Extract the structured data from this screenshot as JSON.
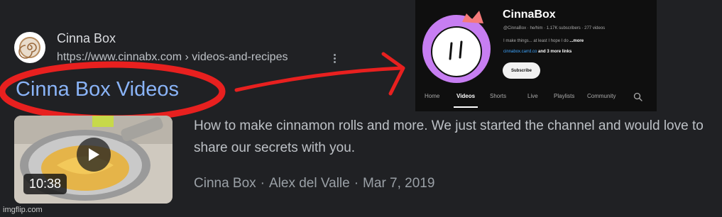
{
  "result": {
    "site_name": "Cinna Box",
    "site_url": "https://www.cinnabx.com › videos-and-recipes",
    "title": "Cinna Box Videos",
    "duration": "10:38",
    "description": "How to make cinnamon rolls and more. We just started the channel and would love to share our secrets with you.",
    "meta": {
      "source": "Cinna Box",
      "author": "Alex del Valle",
      "date": "Mar 7, 2019",
      "separator": "·"
    }
  },
  "youtube_channel": {
    "name": "CinnaBox",
    "stats": "@CinnaBox · he/him · 1.17K subscribers · 277 videos",
    "about_text": "I make things... at least I hope I do",
    "about_more": "...more",
    "link_text": "cinnabox.carrd.co",
    "more_links": "and 3 more links",
    "subscribe_label": "Subscribe",
    "tabs": [
      {
        "label": "Home"
      },
      {
        "label": "Videos"
      },
      {
        "label": "Shorts"
      },
      {
        "label": "Live"
      },
      {
        "label": "Playlists"
      },
      {
        "label": "Community"
      }
    ],
    "active_tab": "Videos"
  },
  "watermark": "imgflip.com",
  "colors": {
    "background": "#202124",
    "link_blue": "#8ab4f8",
    "annotation_red": "#e8201f",
    "youtube_bg": "#0f0f0f",
    "avatar_purple": "#c77ef2",
    "crown_pink": "#f47a7a"
  },
  "icons": [
    "cinnamon-roll-icon",
    "kebab-menu-icon",
    "play-icon",
    "search-icon",
    "crown-icon"
  ]
}
